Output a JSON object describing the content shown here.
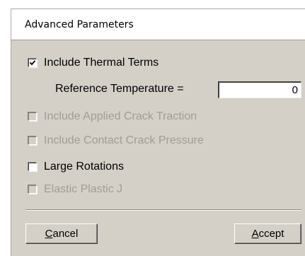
{
  "dialog": {
    "title": "Advanced Parameters"
  },
  "options": {
    "thermal": {
      "label": "Include Thermal Terms",
      "checked": true,
      "enabled": true
    },
    "reference": {
      "label": "Reference Temperature =",
      "value": "0"
    },
    "crack_traction": {
      "label": "Include Applied Crack Traction",
      "checked": false,
      "enabled": false
    },
    "contact_pressure": {
      "label": "Include Contact Crack Pressure",
      "checked": false,
      "enabled": false
    },
    "large_rotations": {
      "label": "Large Rotations",
      "checked": false,
      "enabled": true
    },
    "elastic_plastic": {
      "label": "Elastic Plastic J",
      "checked": false,
      "enabled": false
    }
  },
  "buttons": {
    "cancel": {
      "mnemonic": "C",
      "rest": "ancel"
    },
    "accept": {
      "mnemonic": "A",
      "rest": "ccept"
    }
  },
  "colors": {
    "face": "#d4d0c8",
    "disabled_text": "#a09d96"
  }
}
